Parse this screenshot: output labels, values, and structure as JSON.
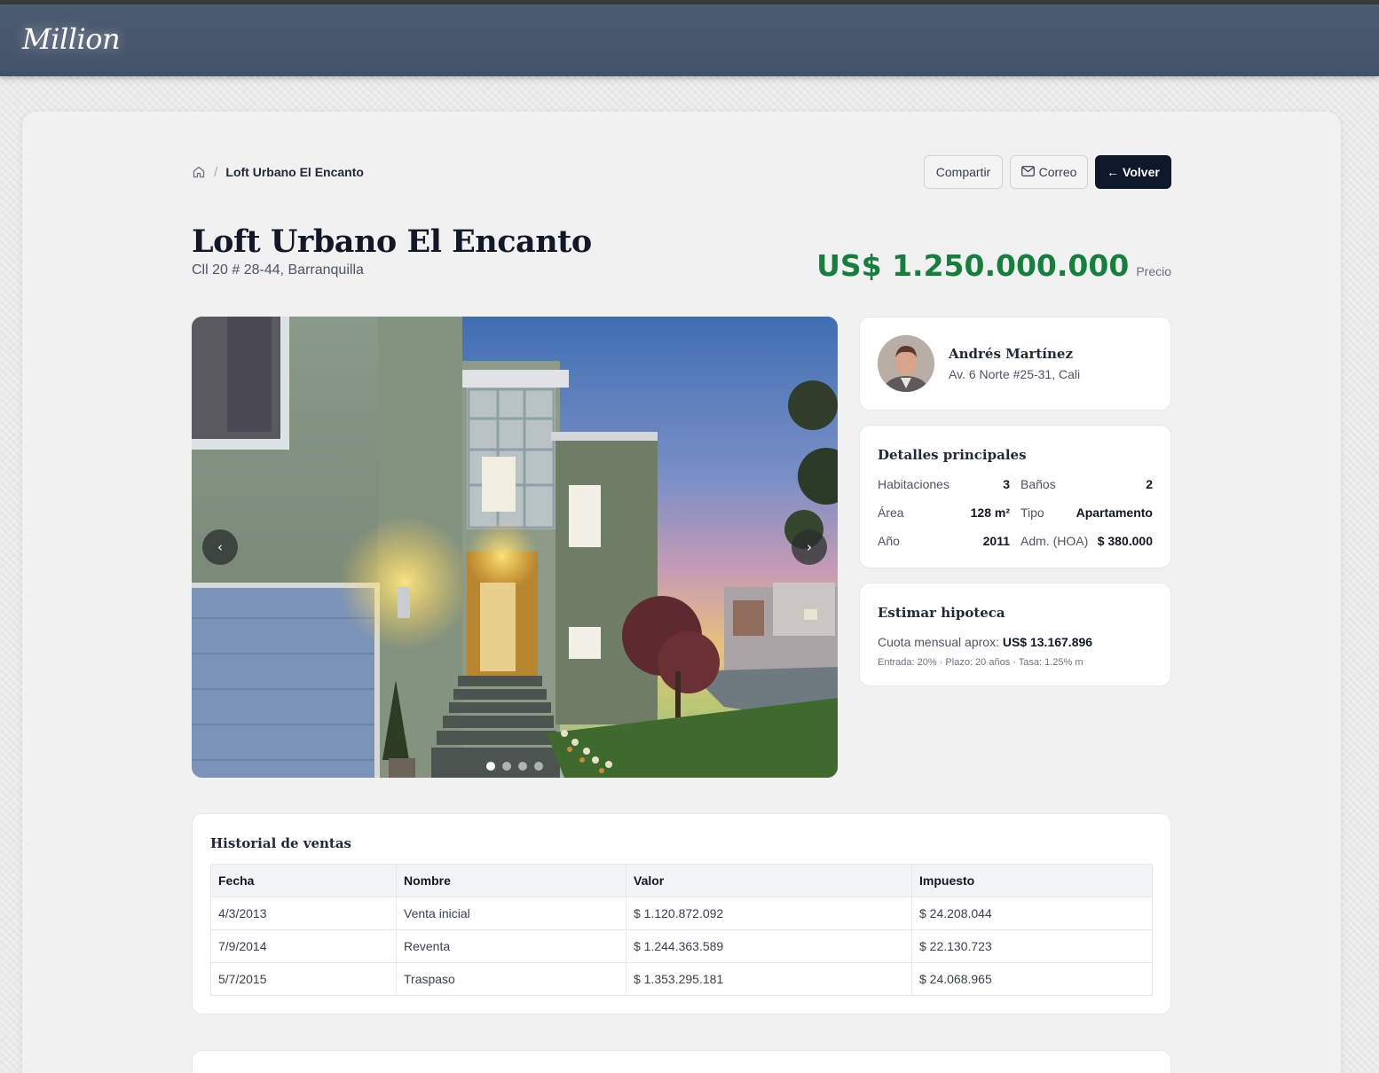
{
  "brand": "Million",
  "breadcrumb": {
    "home_icon": "home-icon",
    "current": "Loft Urbano El Encanto"
  },
  "actions": {
    "share": "Compartir",
    "mail": "Correo",
    "mail_icon": "mail-icon",
    "back": "← Volver"
  },
  "property": {
    "title": "Loft Urbano El Encanto",
    "address": "Cll 20 # 28-44, Barranquilla",
    "price": "US$ 1.250.000.000",
    "price_label": "Precio"
  },
  "gallery": {
    "prev": "‹",
    "next": "›",
    "slide_count": 4,
    "active_index": 0
  },
  "agent": {
    "name": "Andrés Martínez",
    "address": "Av. 6 Norte #25-31, Cali"
  },
  "details": {
    "title": "Detalles principales",
    "rows": [
      {
        "l1": "Habitaciones",
        "v1": "3",
        "l2": "Baños",
        "v2": "2"
      },
      {
        "l1": "Área",
        "v1": "128 m²",
        "l2": "Tipo",
        "v2": "Apartamento"
      },
      {
        "l1": "Año",
        "v1": "2011",
        "l2": "Adm. (HOA)",
        "v2": "$ 380.000"
      }
    ]
  },
  "mortgage": {
    "title": "Estimar hipoteca",
    "label": "Cuota mensual aprox: ",
    "value": "US$ 13.167.896",
    "sub": "Entrada: 20% · Plazo: 20 años · Tasa: 1.25% m"
  },
  "history": {
    "title": "Historial de ventas",
    "columns": [
      "Fecha",
      "Nombre",
      "Valor",
      "Impuesto"
    ],
    "rows": [
      [
        "4/3/2013",
        "Venta inicial",
        "$ 1.120.872.092",
        "$ 24.208.044"
      ],
      [
        "7/9/2014",
        "Reventa",
        "$ 1.244.363.589",
        "$ 22.130.723"
      ],
      [
        "5/7/2015",
        "Traspaso",
        "$ 1.353.295.181",
        "$ 24.068.965"
      ]
    ]
  },
  "colors": {
    "accent": "#15803d",
    "navbar": "#475569",
    "dark_button": "#0f172a"
  }
}
